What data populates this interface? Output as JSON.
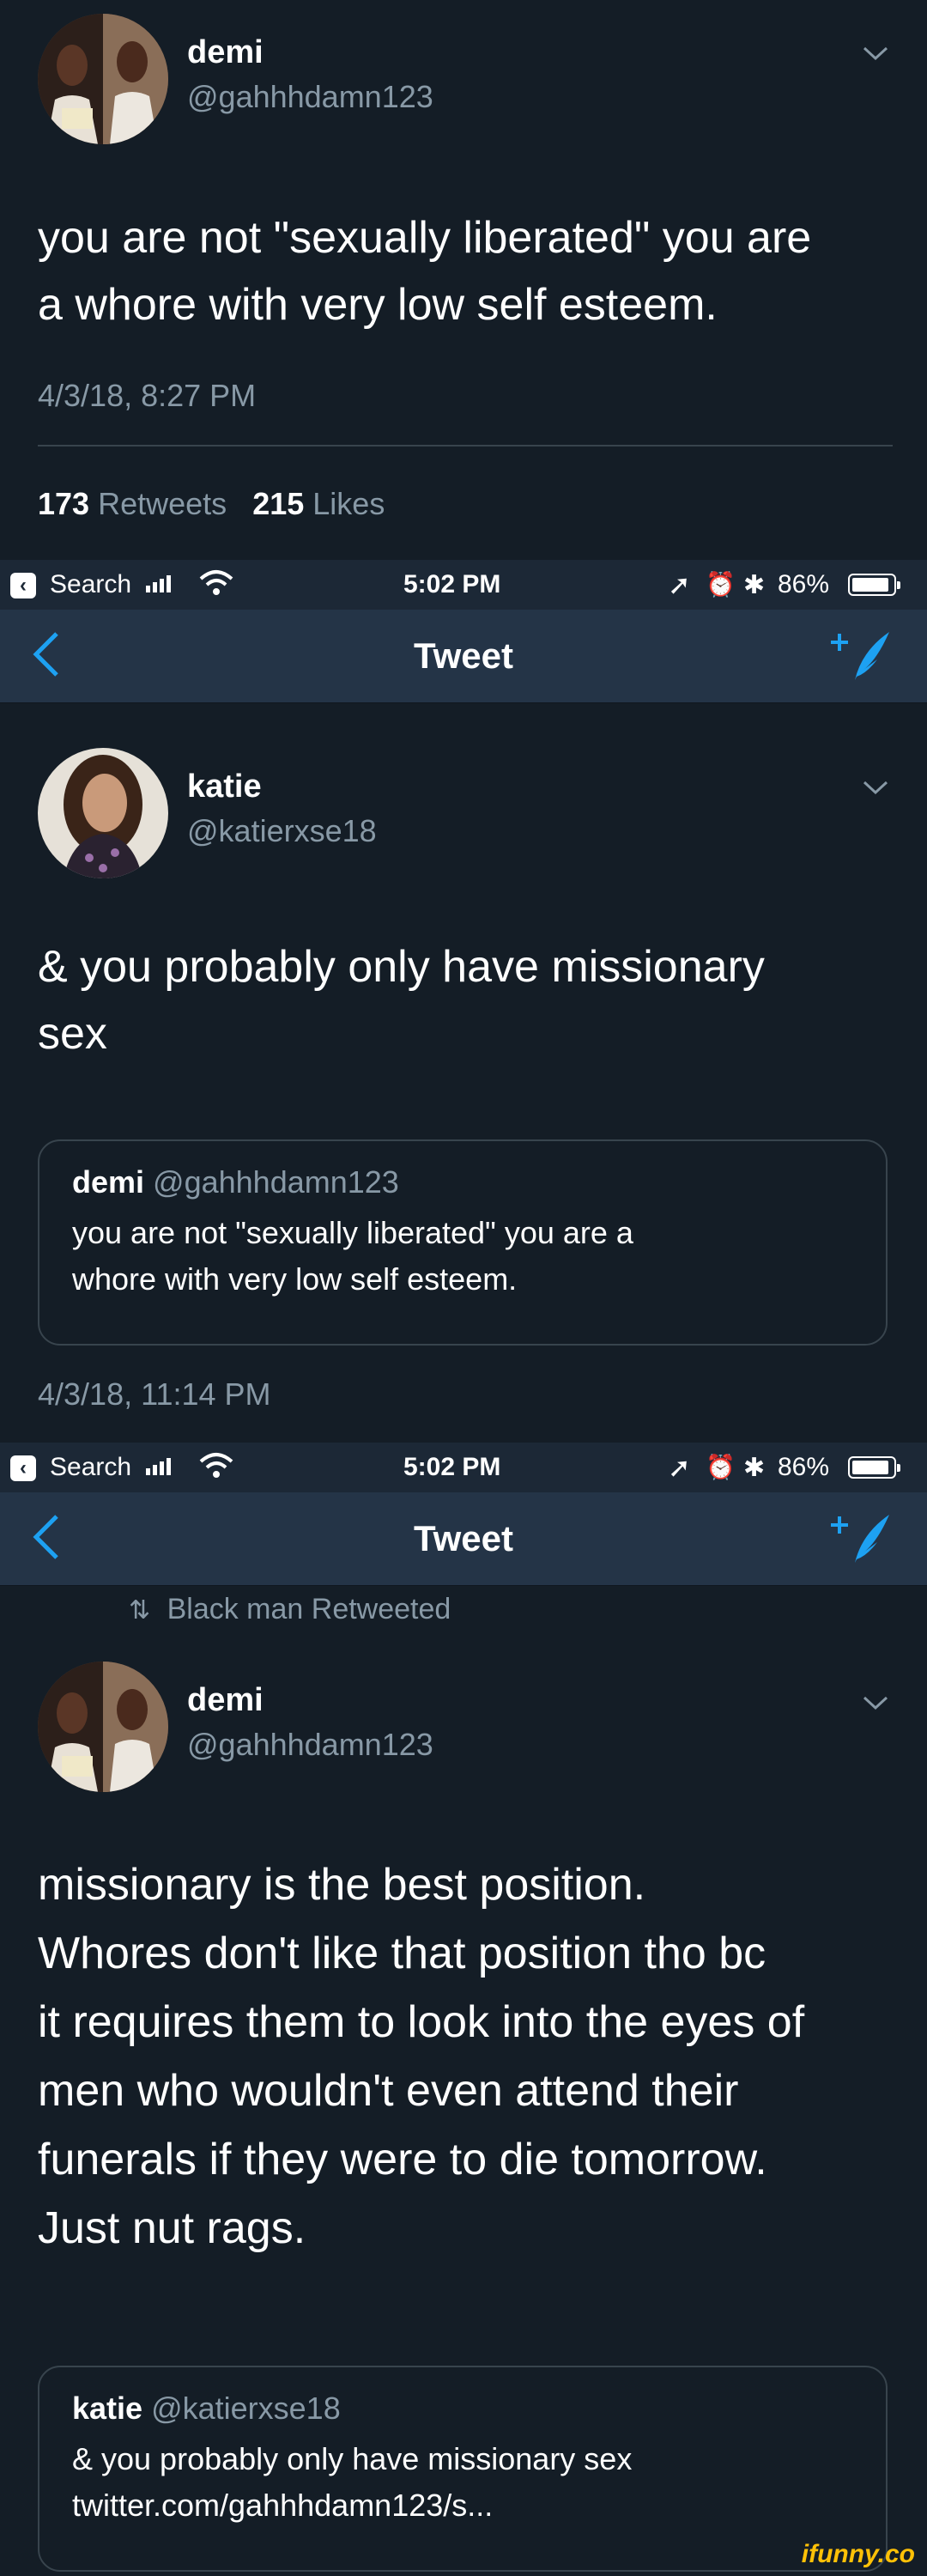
{
  "tweet1": {
    "name": "demi",
    "handle": "@gahhhdamn123",
    "text_lines": [
      "you are not \"sexually liberated\" you are",
      "a whore with very low self esteem."
    ],
    "timestamp": "4/3/18, 8:27 PM",
    "retweets_count": "173",
    "retweets_label": "Retweets",
    "likes_count": "215",
    "likes_label": "Likes"
  },
  "status": {
    "search": "Search",
    "time": "5:02 PM",
    "battery": "86%",
    "battery_level": 0.86
  },
  "nav": {
    "title": "Tweet"
  },
  "tweet2": {
    "name": "katie",
    "handle": "@katierxse18",
    "text_lines": [
      "& you probably only have missionary",
      "sex"
    ],
    "quote": {
      "name": "demi",
      "handle": "@gahhhdamn123",
      "body_lines": [
        "you are not \"sexually liberated\" you are a",
        "whore with very low self esteem."
      ]
    },
    "timestamp": "4/3/18, 11:14 PM"
  },
  "tweet3": {
    "retweeted_by": "Black man Retweeted",
    "name": "demi",
    "handle": "@gahhhdamn123",
    "text_lines": [
      "missionary is the best position.",
      "Whores don't like that position tho bc",
      "it requires them to look into the eyes of",
      "men who wouldn't even attend their",
      "funerals if they were to die tomorrow.",
      "Just nut rags."
    ],
    "quote": {
      "name": "katie",
      "handle": "@katierxse18",
      "body_lines": [
        "& you probably only have missionary sex",
        "twitter.com/gahhhdamn123/s..."
      ]
    }
  },
  "watermark": "ifunny.co",
  "colors": {
    "background": "#141d26",
    "navbar": "#243447",
    "statusbar": "#1c2836",
    "accent": "#1da1f2",
    "muted": "#8899a6",
    "border": "#38444d"
  }
}
